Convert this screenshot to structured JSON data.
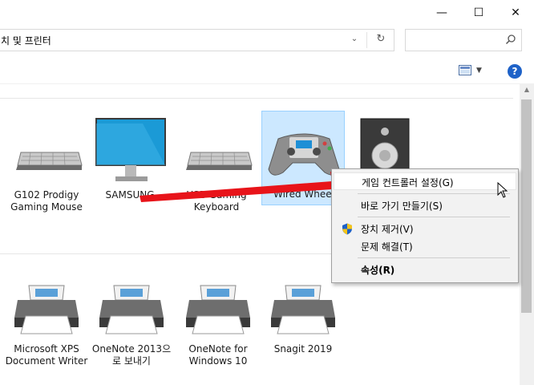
{
  "window": {
    "minimize_glyph": "—",
    "maximize_glyph": "☐",
    "close_glyph": "✕"
  },
  "address": {
    "path": "치 및 프린터",
    "chevron_glyph": "⌄",
    "refresh_glyph": "↻"
  },
  "search": {
    "placeholder": "",
    "icon": "search-icon"
  },
  "toolbar": {
    "view_icon": "view-options-icon",
    "dropdown_glyph": "▼",
    "help_glyph": "?"
  },
  "devices": [
    {
      "label": "G102 Prodigy Gaming Mouse",
      "icon": "keyboard-icon"
    },
    {
      "label": "SAMSUNG",
      "icon": "monitor-icon"
    },
    {
      "label": "USB Gaming Keyboard",
      "icon": "keyboard-icon"
    },
    {
      "label": "Wired Wheel",
      "icon": "gamepad-icon"
    },
    {
      "label": "",
      "icon": "speaker-icon"
    }
  ],
  "printers": [
    {
      "label": "Microsoft XPS Document Writer",
      "icon": "printer-icon"
    },
    {
      "label": "OneNote 2013으로 보내기",
      "icon": "printer-icon"
    },
    {
      "label": "OneNote for Windows 10",
      "icon": "printer-icon"
    },
    {
      "label": "Snagit 2019",
      "icon": "printer-icon"
    }
  ],
  "context_menu": {
    "items": [
      {
        "label": "게임 컨트롤러 설정(G)",
        "highlighted": true
      },
      {
        "label": "바로 가기 만들기(S)"
      },
      {
        "label": "장치 제거(V)",
        "icon": "uac-shield-icon"
      },
      {
        "label": "문제 해결(T)"
      },
      {
        "label": "속성(R)",
        "bold": true
      }
    ]
  },
  "colors": {
    "accent": "#1e62c8",
    "selection_fill": "#cce8ff",
    "selection_border": "#99d1ff",
    "annotation_arrow": "#e8141a"
  }
}
